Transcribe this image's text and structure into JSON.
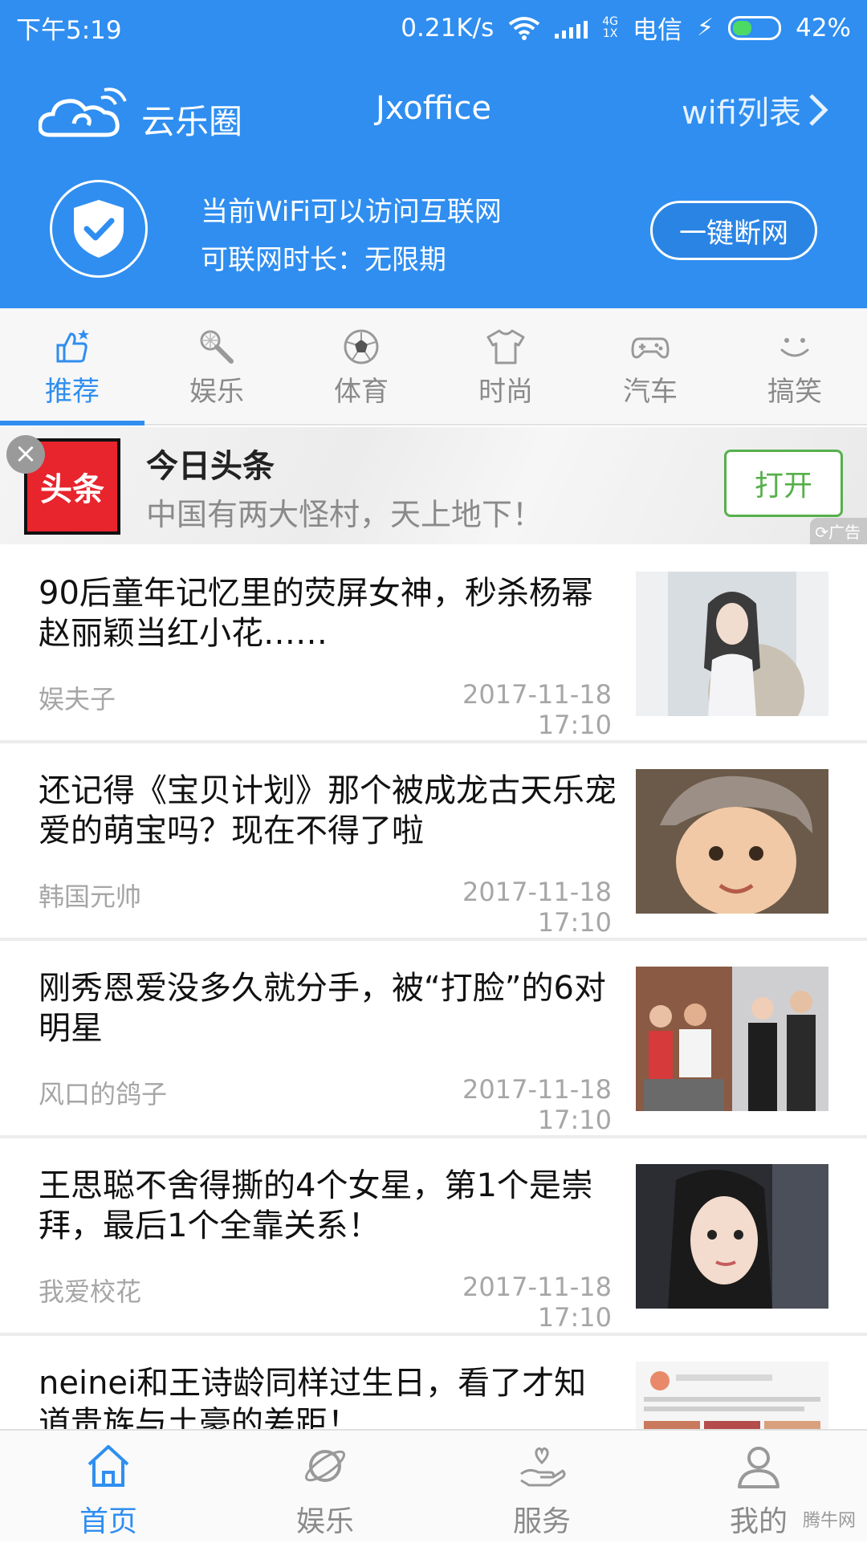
{
  "status_bar": {
    "time": "下午5:19",
    "speed": "0.21K/s",
    "network_type_top": "4G",
    "network_type_bottom": "1X",
    "carrier": "电信",
    "battery": "42%",
    "battery_level": 0.42
  },
  "header": {
    "brand": "云乐圈",
    "ssid": "Jxoffice",
    "wifi_list": "wifi列表",
    "status_line1": "当前WiFi可以访问互联网",
    "status_line2": "可联网时长：无限期",
    "disconnect_button": "一键断网",
    "colors": {
      "primary": "#2f8ef0"
    }
  },
  "tabs": [
    {
      "label": "推荐",
      "icon": "thumbs-up-icon",
      "active": true
    },
    {
      "label": "娱乐",
      "icon": "microphone-icon",
      "active": false
    },
    {
      "label": "体育",
      "icon": "soccer-ball-icon",
      "active": false
    },
    {
      "label": "时尚",
      "icon": "tshirt-icon",
      "active": false
    },
    {
      "label": "汽车",
      "icon": "gamepad-icon",
      "active": false
    },
    {
      "label": "搞笑",
      "icon": "smile-icon",
      "active": false
    }
  ],
  "ad": {
    "logo_text": "头条",
    "title": "今日头条",
    "description": "中国有两大怪村，天上地下！",
    "open_button": "打开",
    "badge": "广告",
    "close_glyph": "×"
  },
  "news": [
    {
      "title": "90后童年记忆里的荧屏女神，秒杀杨幂赵丽颖当红小花……",
      "source": "娱夫子",
      "time": "2017-11-18 17:10"
    },
    {
      "title": "还记得《宝贝计划》那个被成龙古天乐宠爱的萌宝吗？现在不得了啦",
      "source": "韩国元帅",
      "time": "2017-11-18 17:10"
    },
    {
      "title": "刚秀恩爱没多久就分手，被“打脸”的6对明星",
      "source": "风口的鸽子",
      "time": "2017-11-18 17:10"
    },
    {
      "title": "王思聪不舍得撕的4个女星，第1个是崇拜，最后1个全靠关系！",
      "source": "我爱校花",
      "time": "2017-11-18 17:10"
    },
    {
      "title": "neinei和王诗龄同样过生日，看了才知道贵族与土豪的差距！",
      "source": "",
      "time": ""
    }
  ],
  "bottom_nav": [
    {
      "label": "首页",
      "icon": "home-icon",
      "active": true
    },
    {
      "label": "娱乐",
      "icon": "planet-icon",
      "active": false
    },
    {
      "label": "服务",
      "icon": "heart-hand-icon",
      "active": false
    },
    {
      "label": "我的",
      "icon": "user-icon",
      "active": false
    }
  ],
  "watermark": "腾牛网"
}
